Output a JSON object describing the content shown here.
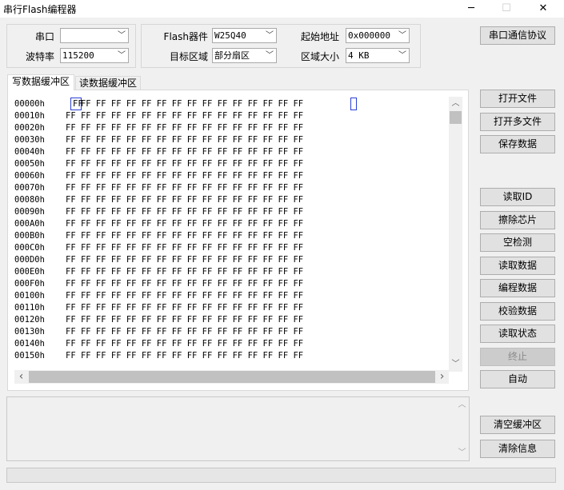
{
  "window": {
    "title": "串行Flash编程器",
    "minimize_glyph": "─",
    "maximize_glyph": "☐",
    "close_glyph": "✕"
  },
  "settings": {
    "port_label": "串口",
    "port_value": "",
    "baud_label": "波特率",
    "baud_value": "115200",
    "flash_label": "Flash器件",
    "flash_value": "W25Q40",
    "target_label": "目标区域",
    "target_value": "部分扇区",
    "start_label": "起始地址",
    "start_value": "0x000000",
    "size_label": "区域大小",
    "size_value": "4 KB"
  },
  "buttons": {
    "protocol": "串口通信协议",
    "open_file": "打开文件",
    "open_multi": "打开多文件",
    "save_data": "保存数据",
    "read_id": "读取ID",
    "erase_chip": "擦除芯片",
    "blank_check": "空检测",
    "read_data": "读取数据",
    "program_data": "编程数据",
    "verify_data": "校验数据",
    "read_status": "读取状态",
    "stop": "终止",
    "auto": "自动",
    "clear_buffer": "清空缓冲区",
    "clear_info": "清除信息"
  },
  "tabs": {
    "write_buffer": "写数据缓冲区",
    "read_buffer": "读数据缓冲区"
  },
  "hex": {
    "first_byte": "FF",
    "rows": [
      {
        "addr": "00000h",
        "bytes": "   FF FF FF FF FF FF FF FF FF FF FF FF FF FF FF"
      },
      {
        "addr": "00010h",
        "bytes": "FF FF FF FF FF FF FF FF FF FF FF FF FF FF FF FF"
      },
      {
        "addr": "00020h",
        "bytes": "FF FF FF FF FF FF FF FF FF FF FF FF FF FF FF FF"
      },
      {
        "addr": "00030h",
        "bytes": "FF FF FF FF FF FF FF FF FF FF FF FF FF FF FF FF"
      },
      {
        "addr": "00040h",
        "bytes": "FF FF FF FF FF FF FF FF FF FF FF FF FF FF FF FF"
      },
      {
        "addr": "00050h",
        "bytes": "FF FF FF FF FF FF FF FF FF FF FF FF FF FF FF FF"
      },
      {
        "addr": "00060h",
        "bytes": "FF FF FF FF FF FF FF FF FF FF FF FF FF FF FF FF"
      },
      {
        "addr": "00070h",
        "bytes": "FF FF FF FF FF FF FF FF FF FF FF FF FF FF FF FF"
      },
      {
        "addr": "00080h",
        "bytes": "FF FF FF FF FF FF FF FF FF FF FF FF FF FF FF FF"
      },
      {
        "addr": "00090h",
        "bytes": "FF FF FF FF FF FF FF FF FF FF FF FF FF FF FF FF"
      },
      {
        "addr": "000A0h",
        "bytes": "FF FF FF FF FF FF FF FF FF FF FF FF FF FF FF FF"
      },
      {
        "addr": "000B0h",
        "bytes": "FF FF FF FF FF FF FF FF FF FF FF FF FF FF FF FF"
      },
      {
        "addr": "000C0h",
        "bytes": "FF FF FF FF FF FF FF FF FF FF FF FF FF FF FF FF"
      },
      {
        "addr": "000D0h",
        "bytes": "FF FF FF FF FF FF FF FF FF FF FF FF FF FF FF FF"
      },
      {
        "addr": "000E0h",
        "bytes": "FF FF FF FF FF FF FF FF FF FF FF FF FF FF FF FF"
      },
      {
        "addr": "000F0h",
        "bytes": "FF FF FF FF FF FF FF FF FF FF FF FF FF FF FF FF"
      },
      {
        "addr": "00100h",
        "bytes": "FF FF FF FF FF FF FF FF FF FF FF FF FF FF FF FF"
      },
      {
        "addr": "00110h",
        "bytes": "FF FF FF FF FF FF FF FF FF FF FF FF FF FF FF FF"
      },
      {
        "addr": "00120h",
        "bytes": "FF FF FF FF FF FF FF FF FF FF FF FF FF FF FF FF"
      },
      {
        "addr": "00130h",
        "bytes": "FF FF FF FF FF FF FF FF FF FF FF FF FF FF FF FF"
      },
      {
        "addr": "00140h",
        "bytes": "FF FF FF FF FF FF FF FF FF FF FF FF FF FF FF FF"
      },
      {
        "addr": "00150h",
        "bytes": "FF FF FF FF FF FF FF FF FF FF FF FF FF FF FF FF"
      }
    ]
  },
  "icons": {
    "dropdown": "chevron-down-icon",
    "scroll_up": "chevron-up-icon",
    "scroll_down": "chevron-down-icon",
    "scroll_left": "chevron-left-icon",
    "scroll_right": "chevron-right-icon"
  },
  "glyphs": {
    "down": "﹀",
    "up": "︿",
    "left": "‹",
    "right": "›"
  },
  "info_text": "",
  "status_text": ""
}
